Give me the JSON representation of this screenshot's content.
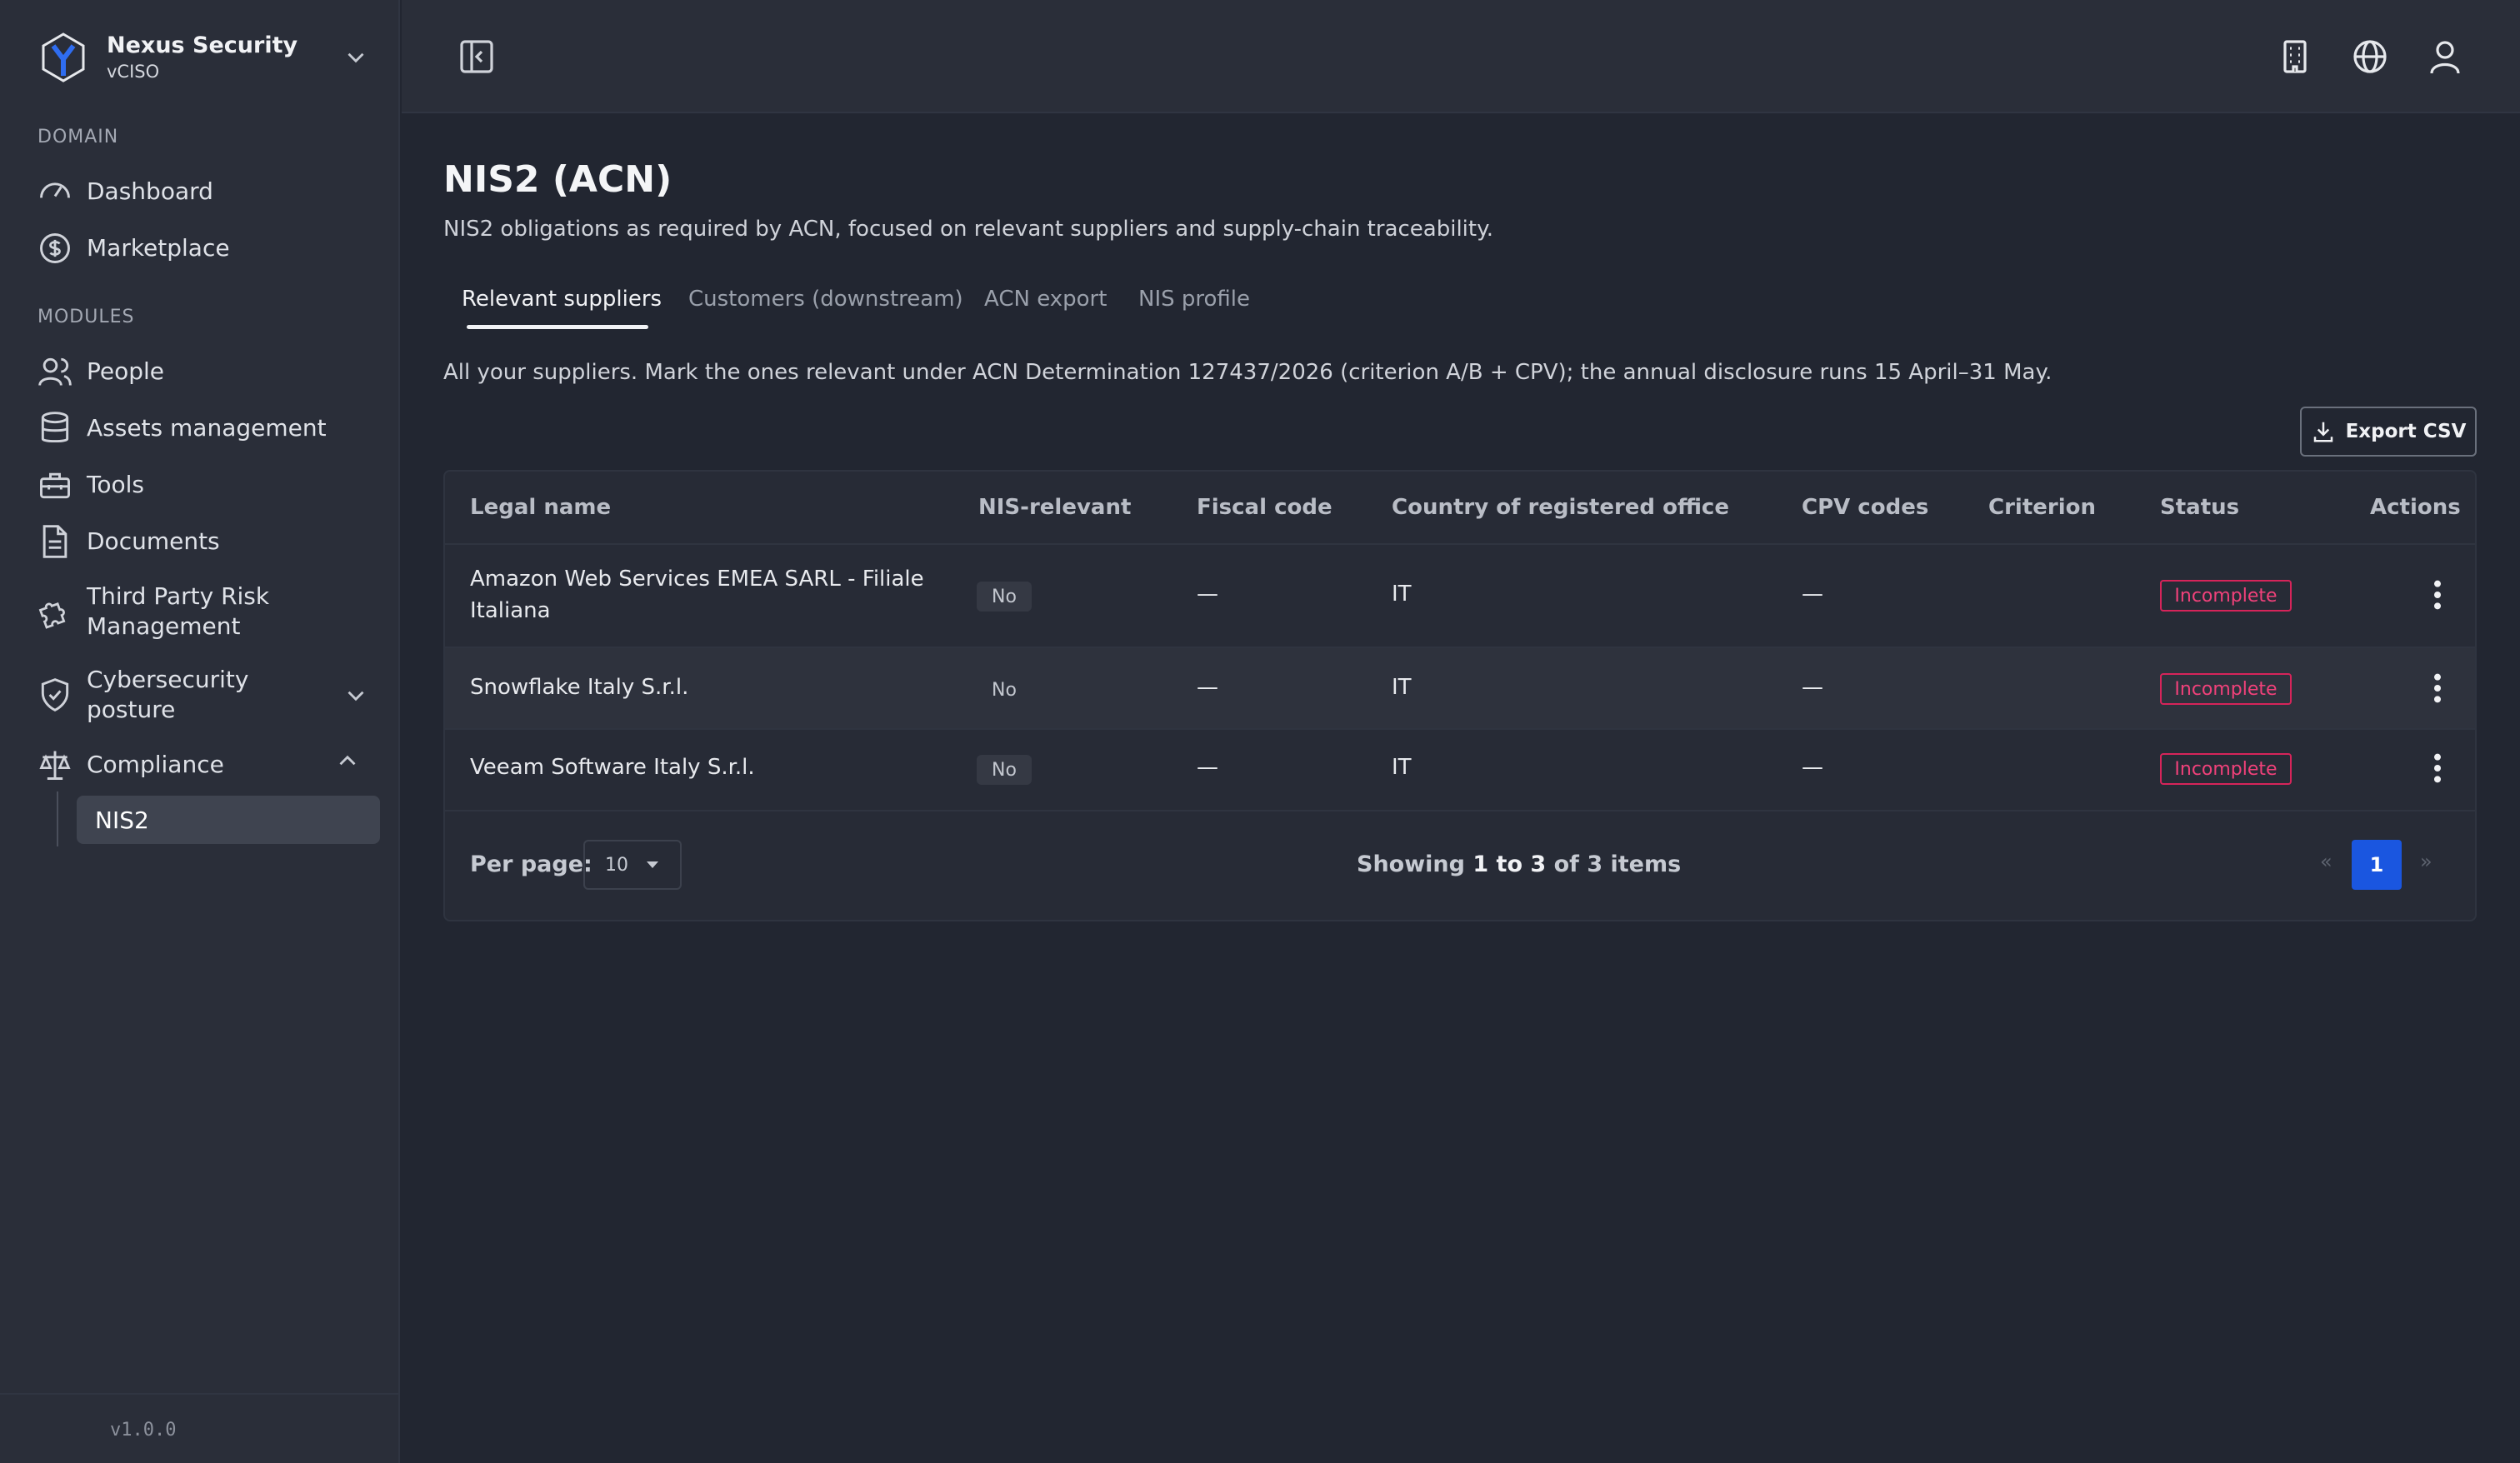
{
  "brand": {
    "name": "Nexus Security",
    "role": "vCISO"
  },
  "sidebar": {
    "sections": [
      {
        "title": "DOMAIN",
        "items": [
          {
            "label": "Dashboard",
            "icon": "gauge-icon"
          },
          {
            "label": "Marketplace",
            "icon": "dollar-coin-icon"
          }
        ]
      },
      {
        "title": "MODULES",
        "items": [
          {
            "label": "People",
            "icon": "users-icon"
          },
          {
            "label": "Assets management",
            "icon": "database-icon"
          },
          {
            "label": "Tools",
            "icon": "toolbox-icon"
          },
          {
            "label": "Documents",
            "icon": "document-icon"
          },
          {
            "label": "Third Party Risk Management",
            "icon": "puzzle-icon"
          },
          {
            "label": "Cybersecurity posture",
            "icon": "shield-check-icon"
          },
          {
            "label": "Compliance",
            "icon": "scale-icon"
          }
        ]
      }
    ],
    "sub_item": "NIS2",
    "version": "v1.0.0"
  },
  "page": {
    "title": "NIS2 (ACN)",
    "description": "NIS2 obligations as required by ACN, focused on relevant suppliers and supply-chain traceability.",
    "tabs": [
      "Relevant suppliers",
      "Customers (downstream)",
      "ACN export",
      "NIS profile"
    ],
    "active_tab": "Relevant suppliers",
    "info": "All your suppliers. Mark the ones relevant under ACN Determination 127437/2026 (criterion A/B + CPV); the annual disclosure runs 15 April–31 May.",
    "export_label": "Export CSV"
  },
  "table": {
    "columns": [
      "Legal name",
      "NIS-relevant",
      "Fiscal code",
      "Country of registered office",
      "CPV codes",
      "Criterion",
      "Status",
      "Actions"
    ],
    "rows": [
      {
        "legal_name": "Amazon Web Services EMEA SARL - Filiale Italiana",
        "nis_relevant": "No",
        "fiscal_code": "—",
        "country": "IT",
        "cpv": "—",
        "criterion": "",
        "status": "Incomplete"
      },
      {
        "legal_name": "Snowflake Italy S.r.l.",
        "nis_relevant": "No",
        "fiscal_code": "—",
        "country": "IT",
        "cpv": "—",
        "criterion": "",
        "status": "Incomplete"
      },
      {
        "legal_name": "Veeam Software Italy S.r.l.",
        "nis_relevant": "No",
        "fiscal_code": "—",
        "country": "IT",
        "cpv": "—",
        "criterion": "",
        "status": "Incomplete"
      }
    ],
    "pagination": {
      "per_page_label": "Per page:",
      "per_page_value": "10",
      "showing_prefix": "Showing",
      "showing_range": "1 to 3",
      "showing_suffix": "of 3 items",
      "prev": "«",
      "current": "1",
      "next": "»"
    }
  },
  "colors": {
    "accent": "#1a56e0",
    "status_incomplete": "#f0417a",
    "background": "#222631",
    "sidebar": "#2a2e39"
  }
}
